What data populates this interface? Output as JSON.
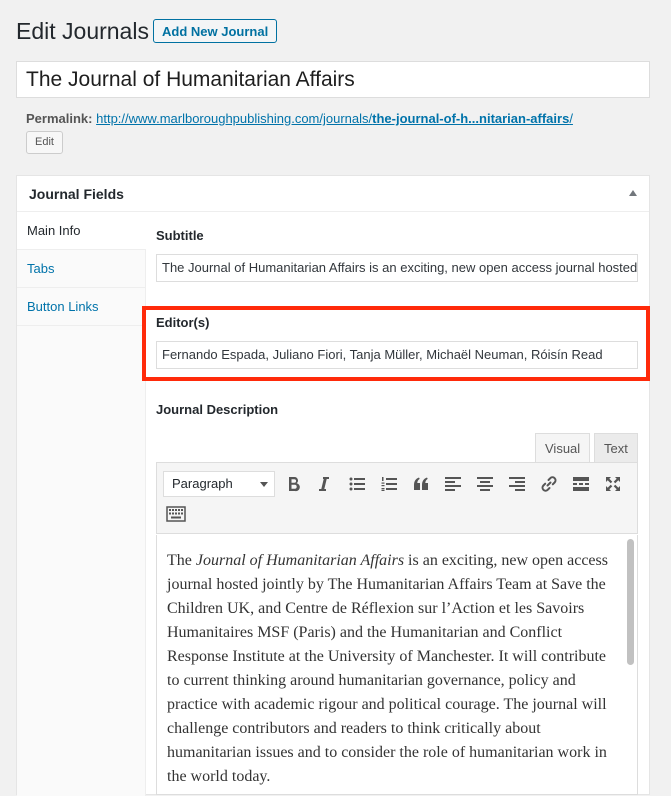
{
  "page": {
    "title": "Edit Journals",
    "add_new_label": "Add New Journal"
  },
  "post": {
    "title": "The Journal of Humanitarian Affairs",
    "permalink_label": "Permalink:",
    "permalink_base": "http://www.marlboroughpublishing.com/journals/",
    "permalink_slug": "the-journal-of-h...nitarian-affairs",
    "permalink_trailing": "/",
    "edit_label": "Edit"
  },
  "metabox": {
    "title": "Journal Fields",
    "tabs": [
      {
        "label": "Main Info"
      },
      {
        "label": "Tabs"
      },
      {
        "label": "Button Links"
      }
    ],
    "subtitle": {
      "label": "Subtitle",
      "value": "The Journal of Humanitarian Affairs is an exciting, new open access journal hosted jointly by"
    },
    "editors": {
      "label": "Editor(s)",
      "value": "Fernando Espada, Juliano Fiori, Tanja Müller, Michaël Neuman, Róisín Read"
    },
    "description": {
      "label": "Journal Description",
      "tab_visual": "Visual",
      "tab_text": "Text",
      "format": "Paragraph",
      "content": {
        "p1": "The ",
        "p1_em": "Journal of Humanitarian Affairs",
        "p2": " is an exciting, new open access journal hosted jointly by The Humanitarian Affairs Team at Save the Children UK, and Centre de Réflexion sur l’Action et les Savoirs Humanitaires MSF (Paris) and the Humanitarian and Conflict Response Institute at the University of Manchester. It will contribute to current thinking around humanitarian governance, policy and practice with academic rigour and political courage. The journal will challenge contributors and readers to think critically about humanitarian issues and to consider the role of humanitarian work in the world today."
      }
    }
  },
  "colors": {
    "link": "#0073aa",
    "highlight": "#ff2a0a"
  }
}
